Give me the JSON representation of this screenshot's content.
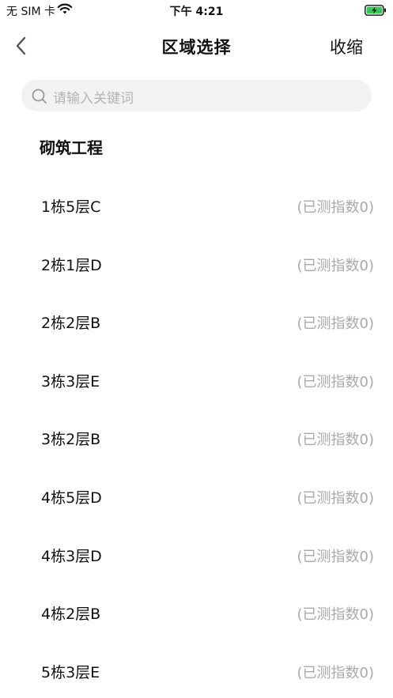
{
  "status": {
    "carrier": "无 SIM 卡",
    "time": "下午 4:21"
  },
  "nav": {
    "title": "区域选择",
    "collapse_label": "收缩"
  },
  "search": {
    "placeholder": "请输入关键词"
  },
  "section": {
    "title": "砌筑工程"
  },
  "areas": [
    {
      "name": "1栋5层C",
      "count": "(已测指数0)"
    },
    {
      "name": "2栋1层D",
      "count": "(已测指数0)"
    },
    {
      "name": "2栋2层B",
      "count": "(已测指数0)"
    },
    {
      "name": "3栋3层E",
      "count": "(已测指数0)"
    },
    {
      "name": "3栋2层B",
      "count": "(已测指数0)"
    },
    {
      "name": "4栋5层D",
      "count": "(已测指数0)"
    },
    {
      "name": "4栋3层D",
      "count": "(已测指数0)"
    },
    {
      "name": "4栋2层B",
      "count": "(已测指数0)"
    },
    {
      "name": "5栋3层E",
      "count": "(已测指数0)"
    }
  ],
  "icons": {
    "wifi": "wifi-icon",
    "battery": "battery-charging-icon",
    "back": "chevron-left-icon",
    "search": "search-icon"
  },
  "colors": {
    "battery_fill": "#35c759",
    "placeholder": "#b4b4b4",
    "secondary_text": "#a9a9a9",
    "search_bg": "#f2f2f2"
  }
}
